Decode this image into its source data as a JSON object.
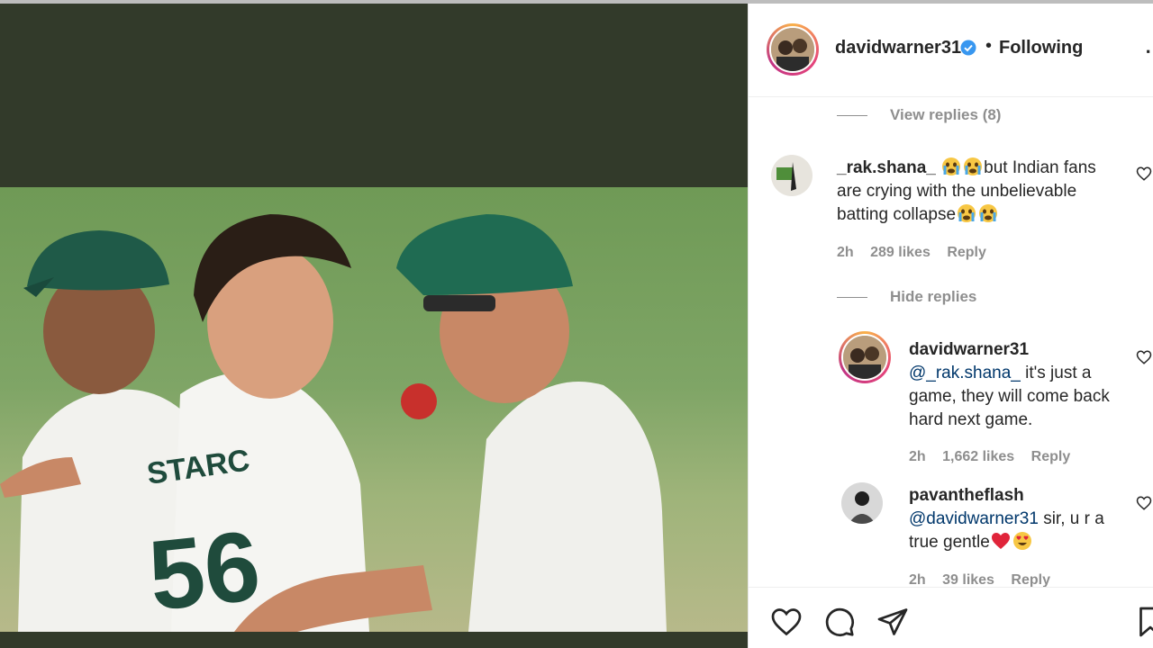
{
  "post": {
    "author": "davidwarner31",
    "follow_status": "Following",
    "separator": "•",
    "more": "⋯"
  },
  "thread": {
    "view_replies": "View replies (8)",
    "hide_replies": "Hide replies"
  },
  "comments": [
    {
      "user": "_rak.shana_",
      "text_before": "",
      "text_after": "but Indian fans are crying with the unbelievable batting collapse",
      "time": "2h",
      "likes": "289 likes",
      "reply": "Reply"
    },
    {
      "user": "davidwarner31",
      "mention": "@_rak.shana_",
      "text": " it's just a game, they will come back hard next game.",
      "time": "2h",
      "likes": "1,662 likes",
      "reply": "Reply"
    },
    {
      "user": "pavantheflash",
      "mention": "@davidwarner31",
      "text": " sir, u r a true gentle",
      "time": "2h",
      "likes": "39 likes",
      "reply": "Reply"
    }
  ],
  "photo_text": {
    "jersey_name": "STARC",
    "jersey_number": "56"
  },
  "icons": [
    "verified-icon",
    "heart-icon",
    "comment-icon",
    "share-icon",
    "bookmark-icon",
    "like-comment-icon"
  ],
  "colors": {
    "mention": "#00376b",
    "verified": "#3897f0",
    "meta": "#8e8e8e",
    "media_bg": "#323a2a"
  }
}
